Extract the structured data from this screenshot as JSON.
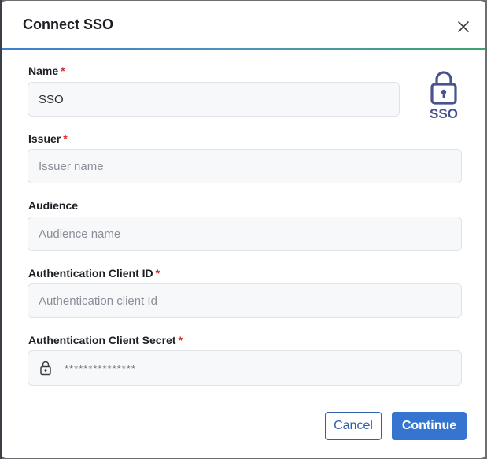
{
  "dialog": {
    "title": "Connect SSO",
    "close_icon": "close-icon"
  },
  "brand": {
    "accent": "#3574cf",
    "required_color": "#d42a2a",
    "badge_color": "#4a5290",
    "badge_icon": "lock-icon",
    "badge_text": "SSO"
  },
  "fields": {
    "name": {
      "label": "Name",
      "required_mark": "*",
      "value": "SSO",
      "placeholder": ""
    },
    "issuer": {
      "label": "Issuer",
      "required_mark": "*",
      "value": "",
      "placeholder": "Issuer name"
    },
    "audience": {
      "label": "Audience",
      "value": "",
      "placeholder": "Audience name"
    },
    "client_id": {
      "label": "Authentication Client ID",
      "required_mark": "*",
      "value": "",
      "placeholder": "Authentication client Id"
    },
    "client_secret": {
      "label": "Authentication Client Secret",
      "required_mark": "*",
      "value": "",
      "placeholder": "***************",
      "icon": "lock-icon"
    }
  },
  "actions": {
    "cancel_label": "Cancel",
    "continue_label": "Continue"
  }
}
